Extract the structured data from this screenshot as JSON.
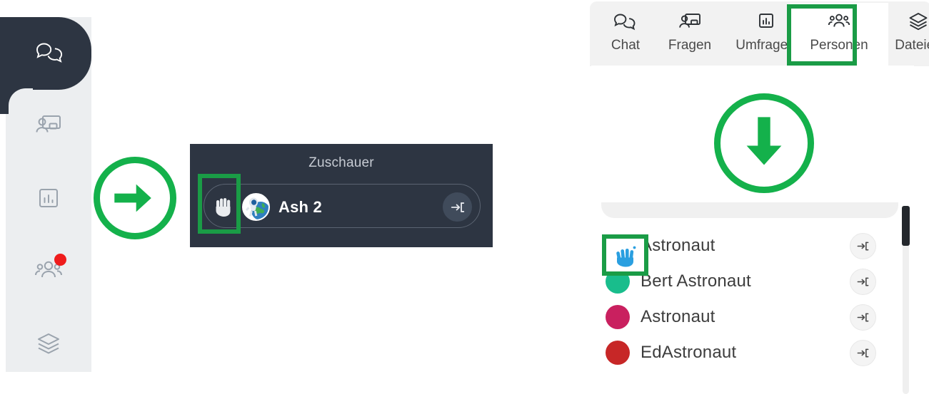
{
  "sidebar": {
    "items": [
      {
        "name": "Chat",
        "icon": "chat-bubbles-icon",
        "active": true,
        "badge": false
      },
      {
        "name": "Fragen",
        "icon": "presenter-screen-icon",
        "active": false,
        "badge": false
      },
      {
        "name": "Umfragen",
        "icon": "bar-chart-box-icon",
        "active": false,
        "badge": false
      },
      {
        "name": "Personen",
        "icon": "people-group-icon",
        "active": false,
        "badge": true
      },
      {
        "name": "Dateien",
        "icon": "layers-stack-icon",
        "active": false,
        "badge": false
      }
    ],
    "active_background": "#2d3542",
    "rail_background": "#eceef0",
    "badge_color": "#ef1c1c"
  },
  "annotations": {
    "accent_color": "#14b14b",
    "rect_color": "#1a9c46",
    "arrow_right": {
      "icon": "arrow-right-icon"
    },
    "arrow_down": {
      "icon": "arrow-down-icon"
    },
    "highlight_hand_dark": {
      "target": "raise-hand-icon"
    },
    "highlight_tab_personen": {
      "target": "tab-personen"
    },
    "highlight_hand_list": {
      "target": "raised-hand-icon"
    }
  },
  "zuschauer_panel": {
    "title": "Zuschauer",
    "background": "#2d3542",
    "viewer": {
      "hand_icon": "raise-hand-icon",
      "avatar_icon": "astronaut-earth-avatar",
      "name": "Ash 2",
      "exit_icon": "exit-arrow-icon"
    }
  },
  "tabbar": {
    "background": "#f2f2f2",
    "selected": "Personen",
    "tabs": [
      {
        "label": "Chat",
        "icon": "chat-bubbles-icon",
        "selected": false
      },
      {
        "label": "Fragen",
        "icon": "presenter-screen-icon",
        "selected": false
      },
      {
        "label": "Umfragen",
        "icon": "bar-chart-box-icon",
        "selected": false
      },
      {
        "label": "Personen",
        "icon": "people-group-icon",
        "selected": true
      },
      {
        "label": "Dateien",
        "icon": "layers-stack-icon",
        "selected": false
      }
    ]
  },
  "participants": {
    "rows": [
      {
        "name": "Astronaut",
        "marker": "raised-hand-icon",
        "color": "#2a9fe0",
        "exit_icon": "exit-arrow-icon"
      },
      {
        "name": "Bert Astronaut",
        "marker": "avatar-dot",
        "color": "#19bd8c",
        "exit_icon": "exit-arrow-icon"
      },
      {
        "name": "Astronaut",
        "marker": "avatar-dot",
        "color": "#c9205f",
        "exit_icon": "exit-arrow-icon"
      },
      {
        "name": "EdAstronaut",
        "marker": "avatar-dot",
        "color": "#c72727",
        "exit_icon": "exit-arrow-icon"
      }
    ],
    "scrollbar": {
      "thumb_color": "#23272c",
      "track_color": "#efefef"
    }
  }
}
